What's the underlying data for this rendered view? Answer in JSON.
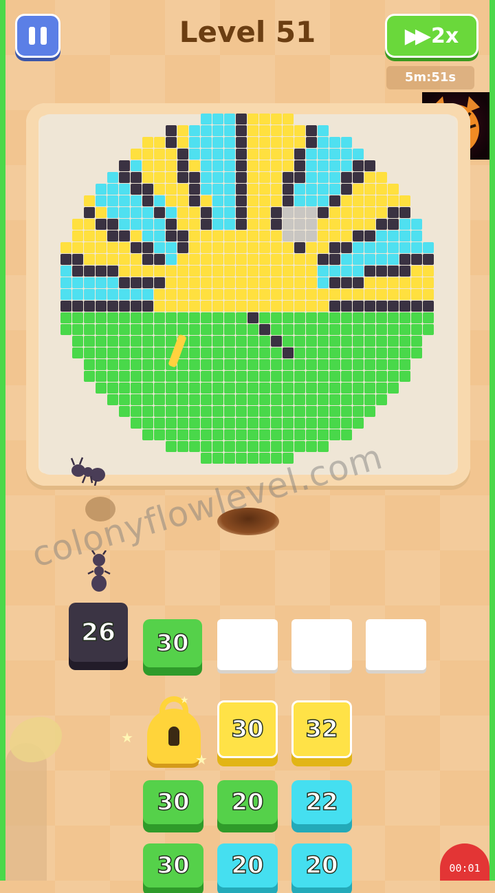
{
  "header": {
    "level_title": "Level 51",
    "speed_label": "2x",
    "timer": "5m:51s"
  },
  "watermark": "colonyflowlevel.com",
  "slots": {
    "active": [
      {
        "value": "26",
        "color": "dark"
      },
      {
        "value": "30",
        "color": "green"
      }
    ],
    "empty_count": 3
  },
  "queue": {
    "row1": [
      {
        "value": "",
        "color": "locked"
      },
      {
        "value": "30",
        "color": "yellow"
      },
      {
        "value": "32",
        "color": "yellow"
      }
    ],
    "row2": [
      {
        "value": "30",
        "color": "green"
      },
      {
        "value": "20",
        "color": "green"
      },
      {
        "value": "22",
        "color": "cyan"
      }
    ],
    "row3": [
      {
        "value": "30",
        "color": "green"
      },
      {
        "value": "20",
        "color": "cyan"
      },
      {
        "value": "20",
        "color": "cyan"
      }
    ]
  },
  "recording": "00:01",
  "colors": {
    "yellow": "#ffe03f",
    "cyan": "#4fe0f0",
    "green": "#49d84a",
    "dark": "#3a3242",
    "mystery": "#c9c6c2"
  },
  "icons": [
    "pause-icon",
    "fast-forward-icon",
    "lock-icon",
    "ant-icon",
    "tiger-avatar-icon"
  ]
}
